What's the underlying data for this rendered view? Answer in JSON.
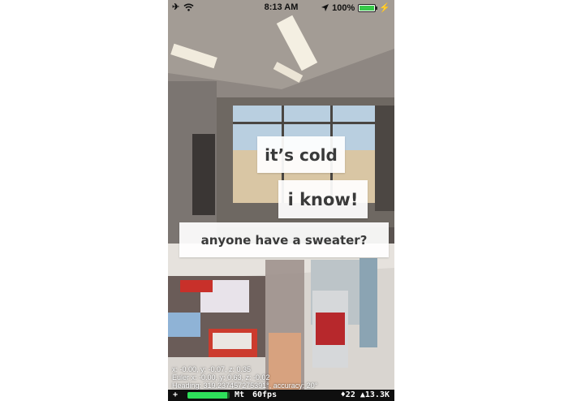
{
  "status_bar": {
    "time": "8:13 AM",
    "battery": "100%",
    "battery_level": 1.0,
    "icons": [
      "airplane-icon",
      "wifi-icon",
      "location-arrow-icon",
      "battery-icon",
      "charging-icon"
    ]
  },
  "bubbles": [
    {
      "text": "it’s cold"
    },
    {
      "text": "i know!"
    },
    {
      "text": "anyone have a sweater?"
    }
  ],
  "debug": {
    "position": "x: -0.00, y: -0.07, z: 0.35",
    "euler": "Euler x: -0.00, y: 0.63, z: -0.02",
    "heading": "Heading: 319.237457275391°, accuracy: 20°"
  },
  "perf": {
    "plus": "+",
    "mt": "Mt",
    "fps": "60fps",
    "nodes": "♦22 ▲13.3K",
    "meter_level": 0.95
  },
  "colors": {
    "bubble_bg": "#ffffff",
    "bubble_text": "#3a3a3a",
    "battery_fill": "#37c84a",
    "perf_meter": "#2ee05a"
  }
}
